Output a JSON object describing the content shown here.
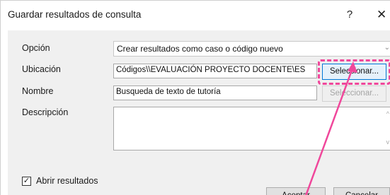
{
  "dialog": {
    "title": "Guardar resultados de consulta",
    "help_label": "?",
    "close_label": "✕"
  },
  "option": {
    "label": "Opción",
    "selected": "Crear resultados como caso o código nuevo"
  },
  "location": {
    "label": "Ubicación",
    "value": "Códigos\\\\EVALUACIÓN PROYECTO DOCENTE\\ES",
    "select_label": "Seleccionar..."
  },
  "name": {
    "label": "Nombre",
    "value": "Busqueda de texto de tutoría",
    "select_label": "Seleccionar..."
  },
  "description": {
    "label": "Descripción",
    "value": ""
  },
  "open_results": {
    "label": "Abrir resultados",
    "checked": true
  },
  "footer": {
    "accept_label": "Aceptar",
    "cancel_label": "Cancelar"
  },
  "colors": {
    "highlight": "#f0479b",
    "background": "#f0f0f0"
  }
}
